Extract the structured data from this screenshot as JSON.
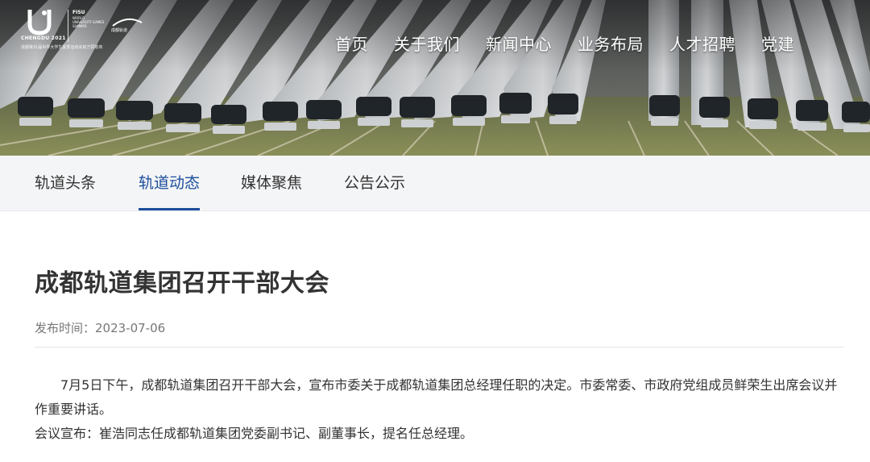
{
  "logo": {
    "brand_text": "CHENGDU 2021",
    "fisu_text": "FISU",
    "fisu_sub": "WORLD UNIVERSITY GAMES SUMMER",
    "metro_text": "成都轨道",
    "caption": "成都第31届世界大学生夏季运动会官方赞助商"
  },
  "top_nav": [
    "首页",
    "关于我们",
    "新闻中心",
    "业务布局",
    "人才招聘",
    "党建"
  ],
  "sub_nav": {
    "tabs": [
      "轨道头条",
      "轨道动态",
      "媒体聚焦",
      "公告公示"
    ],
    "active_index": 1
  },
  "article": {
    "title": "成都轨道集团召开干部大会",
    "publish_label": "发布时间：2023-07-06",
    "paragraphs": [
      "7月5日下午，成都轨道集团召开干部大会，宣布市委关于成都轨道集团总经理任职的决定。市委常委、市政府党组成员鲜荣生出席会议并作重要讲话。",
      "会议宣布：崔浩同志任成都轨道集团党委副书记、副董事长，提名任总经理。"
    ]
  },
  "colors": {
    "accent": "#1c4e9b",
    "subnav_bg": "#f4f5f7",
    "text": "#333333",
    "meta": "#777777"
  }
}
